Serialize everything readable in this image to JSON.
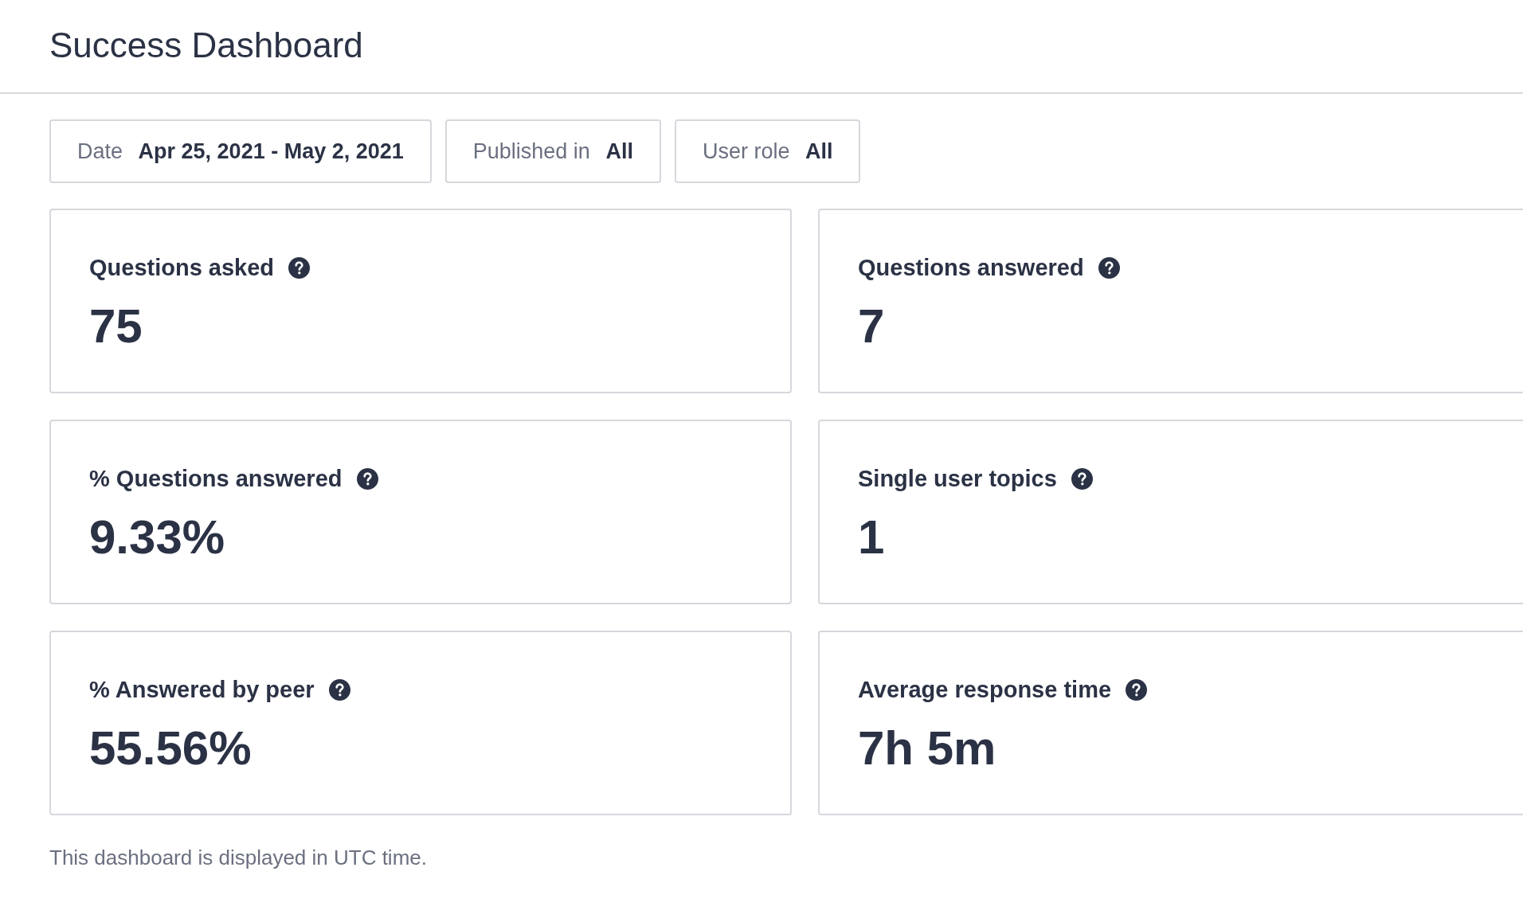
{
  "header": {
    "title": "Success Dashboard"
  },
  "filters": [
    {
      "label": "Date",
      "value": "Apr 25, 2021 - May 2, 2021"
    },
    {
      "label": "Published in",
      "value": "All"
    },
    {
      "label": "User role",
      "value": "All"
    }
  ],
  "metrics": [
    {
      "label": "Questions asked",
      "value": "75"
    },
    {
      "label": "Questions answered",
      "value": "7"
    },
    {
      "label": "% Questions answered",
      "value": "9.33%"
    },
    {
      "label": "Single user topics",
      "value": "1"
    },
    {
      "label": "% Answered by peer",
      "value": "55.56%"
    },
    {
      "label": "Average response time",
      "value": "7h 5m"
    }
  ],
  "footer": {
    "note": "This dashboard is displayed in UTC time."
  }
}
